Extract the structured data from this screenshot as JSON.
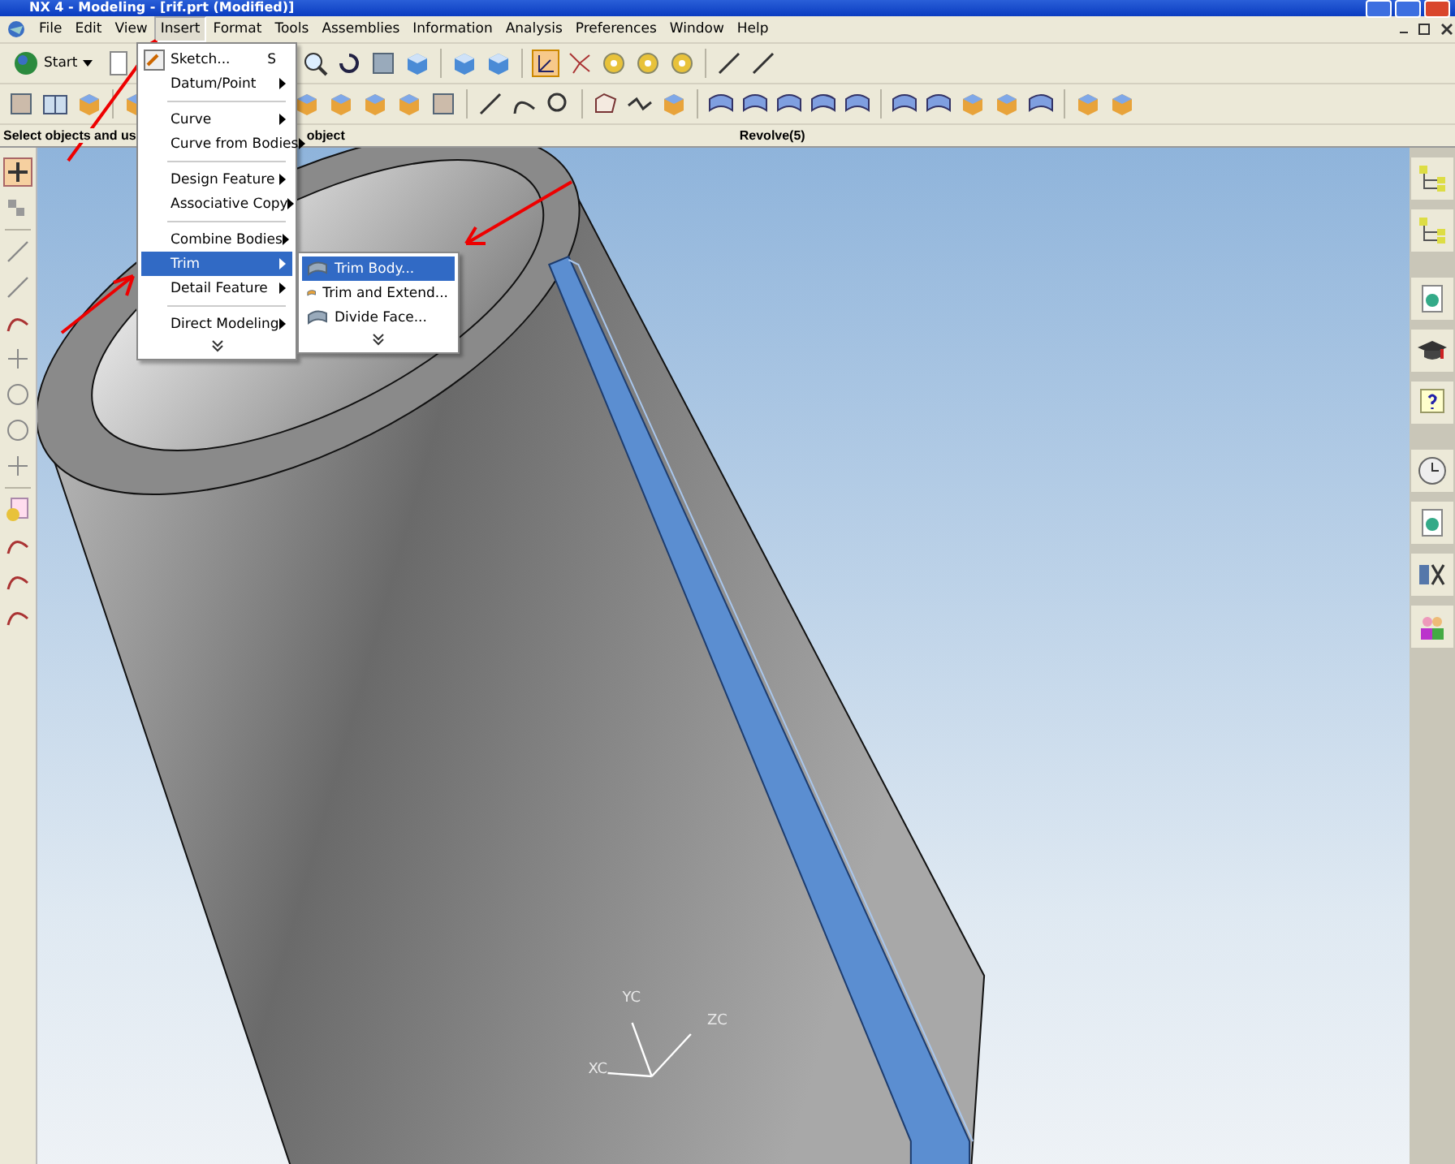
{
  "window": {
    "title": "NX 4 - Modeling - [rif.prt (Modified)]"
  },
  "menu_bar": [
    {
      "label": "File",
      "selected": false
    },
    {
      "label": "Edit",
      "selected": false
    },
    {
      "label": "View",
      "selected": false
    },
    {
      "label": "Insert",
      "selected": true
    },
    {
      "label": "Format",
      "selected": false
    },
    {
      "label": "Tools",
      "selected": false
    },
    {
      "label": "Assemblies",
      "selected": false
    },
    {
      "label": "Information",
      "selected": false
    },
    {
      "label": "Analysis",
      "selected": false
    },
    {
      "label": "Preferences",
      "selected": false
    },
    {
      "label": "Window",
      "selected": false
    },
    {
      "label": "Help",
      "selected": false
    }
  ],
  "toolbar": {
    "start_button": "Start"
  },
  "cue_line": {
    "prompt_start": "Select objects and us",
    "prompt_end": "object",
    "status": "Revolve(5)"
  },
  "insert_menu": [
    {
      "kind": "item",
      "label": "Sketch...",
      "shortcut": "S",
      "submenu": false,
      "selected": false
    },
    {
      "kind": "item",
      "label": "Datum/Point",
      "submenu": true,
      "selected": false
    },
    {
      "kind": "separator"
    },
    {
      "kind": "item",
      "label": "Curve",
      "submenu": true,
      "selected": false
    },
    {
      "kind": "item",
      "label": "Curve from Bodies",
      "submenu": true,
      "selected": false
    },
    {
      "kind": "separator"
    },
    {
      "kind": "item",
      "label": "Design Feature",
      "submenu": true,
      "selected": false
    },
    {
      "kind": "item",
      "label": "Associative Copy",
      "submenu": true,
      "selected": false
    },
    {
      "kind": "separator"
    },
    {
      "kind": "item",
      "label": "Combine Bodies",
      "submenu": true,
      "selected": false
    },
    {
      "kind": "item",
      "label": "Trim",
      "submenu": true,
      "selected": true
    },
    {
      "kind": "item",
      "label": "Detail Feature",
      "submenu": true,
      "selected": false
    },
    {
      "kind": "separator"
    },
    {
      "kind": "item",
      "label": "Direct Modeling",
      "submenu": true,
      "selected": false
    },
    {
      "kind": "expand"
    }
  ],
  "trim_submenu": [
    {
      "kind": "item",
      "label": "Trim Body...",
      "selected": true
    },
    {
      "kind": "item",
      "label": "Trim and Extend...",
      "selected": false
    },
    {
      "kind": "item",
      "label": "Divide Face...",
      "selected": false
    },
    {
      "kind": "expand"
    }
  ],
  "viewport": {
    "axis_labels": [
      "YC",
      "ZC",
      "XC"
    ]
  }
}
